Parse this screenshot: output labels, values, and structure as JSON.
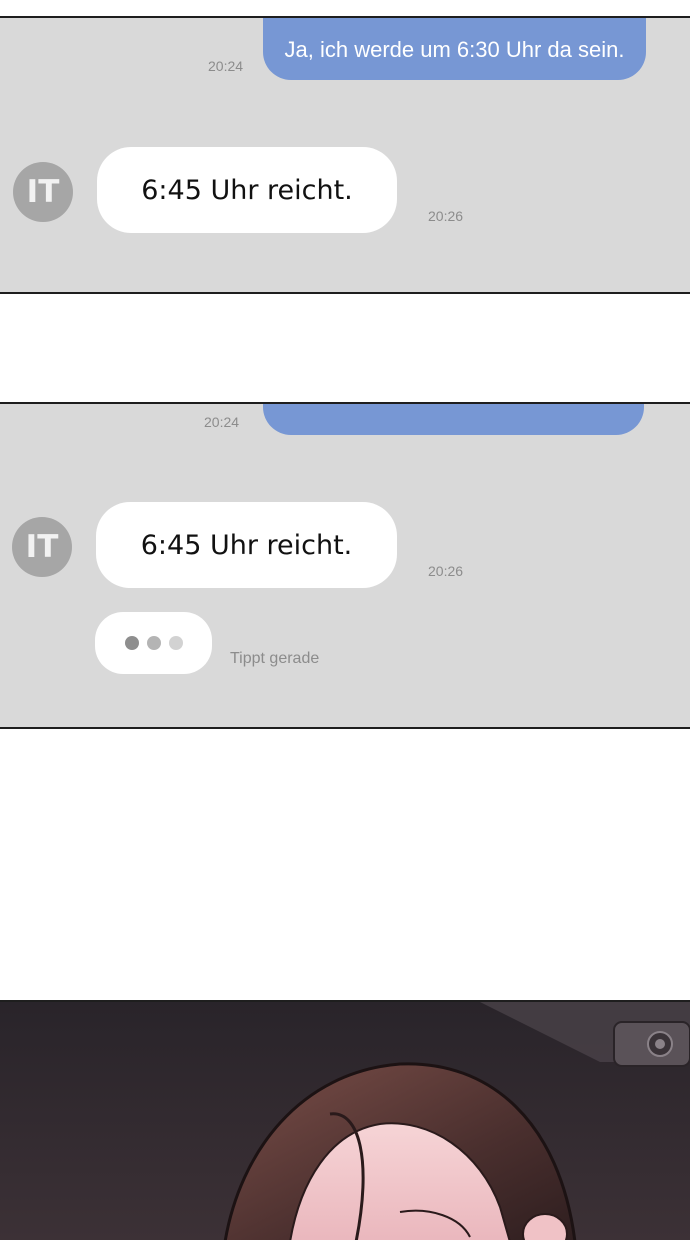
{
  "panel1": {
    "outgoing_message": "Ja, ich werde um 6:30 Uhr da sein.",
    "outgoing_time": "20:24",
    "avatar_initials": "IT",
    "incoming_message": "6:45 Uhr reicht.",
    "incoming_time": "20:26"
  },
  "panel2": {
    "outgoing_time": "20:24",
    "avatar_initials": "IT",
    "incoming_message": "6:45 Uhr reicht.",
    "incoming_time": "20:26",
    "typing_status": "Tippt gerade"
  },
  "colors": {
    "panel_background": "#d9d9d9",
    "outgoing_bubble": "#7797d4",
    "incoming_bubble": "#ffffff",
    "avatar": "#a6a6a6",
    "timestamp": "#8c8c8c"
  }
}
